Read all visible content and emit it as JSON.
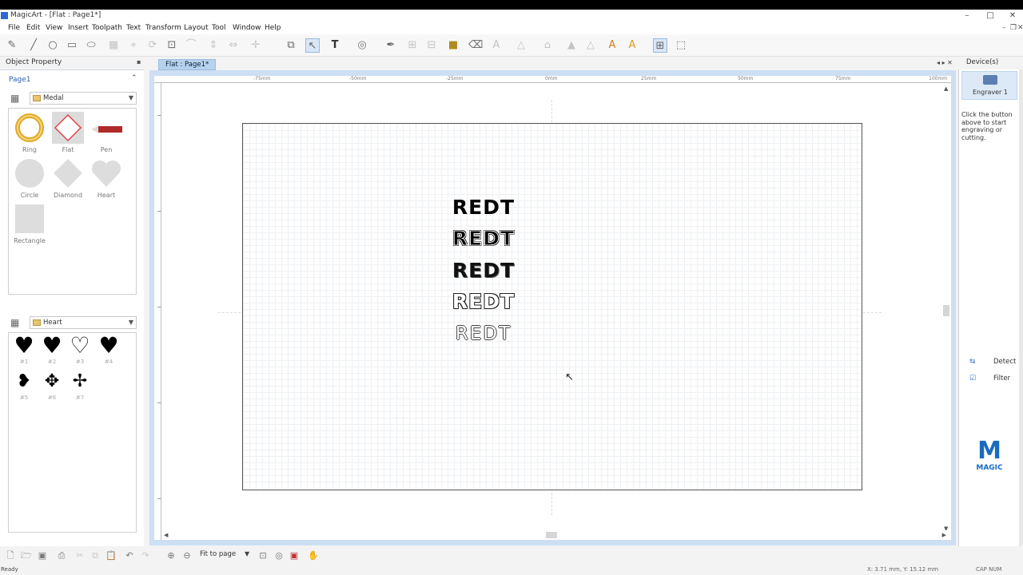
{
  "window": {
    "title": "MagicArt - [Flat : Page1*]",
    "min": "–",
    "max": "□",
    "close": "✕"
  },
  "menu": {
    "items": [
      "File",
      "Edit",
      "View",
      "Insert",
      "Toolpath",
      "Text",
      "Transform",
      "Layout",
      "Tool",
      "Window",
      "Help"
    ],
    "mdi_min": "–",
    "mdi_restore": "❐",
    "mdi_close": "✕"
  },
  "left_panel": {
    "object_property_label": "Object Property",
    "pin_icon": "▪",
    "page_label": "Page1",
    "collapse_icon": "⌃",
    "shape_category": "Medal",
    "shapes": [
      {
        "label": "Ring",
        "icon": "ring-icon"
      },
      {
        "label": "Flat",
        "icon": "flat-icon"
      },
      {
        "label": "Pen",
        "icon": "pen-icon"
      },
      {
        "label": "Circle",
        "icon": "circle-icon"
      },
      {
        "label": "Diamond",
        "icon": "diamond-icon"
      },
      {
        "label": "Heart",
        "icon": "heart-icon"
      },
      {
        "label": "Rectangle",
        "icon": "rectangle-icon"
      }
    ],
    "clipart_category": "Heart",
    "cliparts": [
      {
        "glyph": "♥",
        "label": "#1"
      },
      {
        "glyph": "♥",
        "label": "#2"
      },
      {
        "glyph": "♡",
        "label": "#3"
      },
      {
        "glyph": "♥",
        "label": "#4"
      },
      {
        "glyph": "❥",
        "label": "#5"
      },
      {
        "glyph": "✥",
        "label": "#6"
      },
      {
        "glyph": "✢",
        "label": "#7"
      }
    ]
  },
  "document": {
    "tab_label": "Flat : Page1*",
    "ruler_labels": [
      "-75mm",
      "-50mm",
      "-25mm",
      "0mm",
      "25mm",
      "50mm",
      "75mm",
      "100mm"
    ],
    "text_lines": [
      "REDT",
      "REDT",
      "REDT",
      "REDT",
      "REDT"
    ]
  },
  "bottom_toolbar": {
    "zoom_mode": "Fit to page"
  },
  "right_panel": {
    "devices_label": "Device(s)",
    "device_name": "Engraver 1",
    "hint": "Click the button above to start engraving or cutting.",
    "detect_label": "Detect",
    "filter_label": "Filter",
    "logo_mark": "M",
    "logo_text": "MAGIC"
  },
  "status": {
    "ready": "Ready",
    "coords": "X: 3.71 mm, Y: 15.12 mm",
    "caps": "CAP NUM"
  },
  "colors": {
    "accent": "#2a63b5",
    "tab": "#b6d2ef",
    "logo": "#1a6bc0"
  }
}
